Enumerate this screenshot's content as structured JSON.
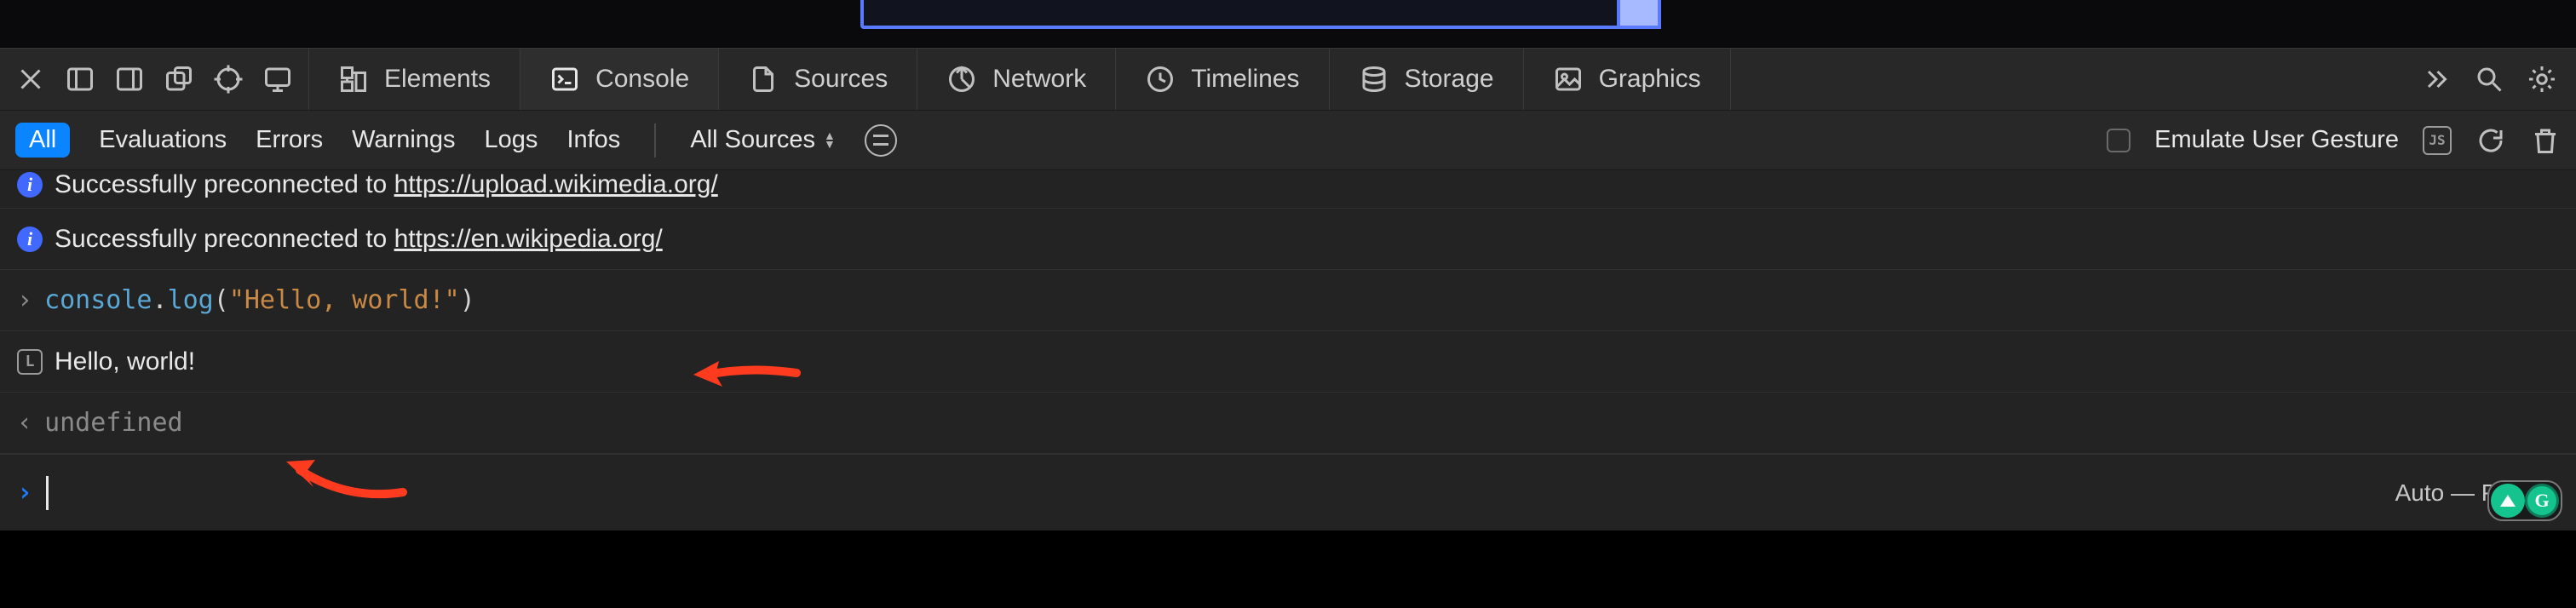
{
  "tabs": {
    "elements": "Elements",
    "console": "Console",
    "sources": "Sources",
    "network": "Network",
    "timelines": "Timelines",
    "storage": "Storage",
    "graphics": "Graphics"
  },
  "filters": {
    "all": "All",
    "evaluations": "Evaluations",
    "errors": "Errors",
    "warnings": "Warnings",
    "logs": "Logs",
    "infos": "Infos",
    "sources_selector": "All Sources",
    "emulate_label": "Emulate User Gesture"
  },
  "logs": {
    "clipped_prefix": "Successfully preconnected to ",
    "clipped_url": "https://upload.wikimedia.org/",
    "info_prefix": "Successfully preconnected to ",
    "info_url": "https://en.wikipedia.org/",
    "input_code": {
      "obj": "console",
      "method": "log",
      "open": "(",
      "string": "\"Hello, world!\"",
      "close": ")"
    },
    "output_text": "Hello, world!",
    "return_value": "undefined"
  },
  "context_selector": "Auto — Page",
  "annotations": {
    "arrow1": "red-arrow-pointing-to-input-code",
    "arrow2": "red-arrow-pointing-to-output"
  }
}
